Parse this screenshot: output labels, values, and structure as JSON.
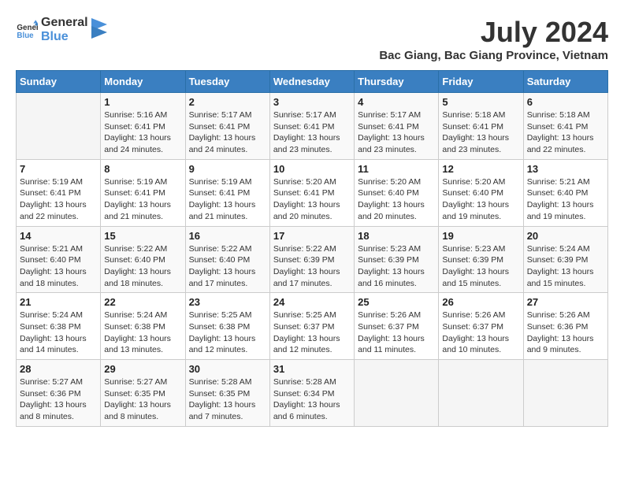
{
  "header": {
    "logo_line1": "General",
    "logo_line2": "Blue",
    "month_year": "July 2024",
    "location": "Bac Giang, Bac Giang Province, Vietnam"
  },
  "days_of_week": [
    "Sunday",
    "Monday",
    "Tuesday",
    "Wednesday",
    "Thursday",
    "Friday",
    "Saturday"
  ],
  "weeks": [
    [
      {
        "day": "",
        "detail": ""
      },
      {
        "day": "1",
        "detail": "Sunrise: 5:16 AM\nSunset: 6:41 PM\nDaylight: 13 hours\nand 24 minutes."
      },
      {
        "day": "2",
        "detail": "Sunrise: 5:17 AM\nSunset: 6:41 PM\nDaylight: 13 hours\nand 24 minutes."
      },
      {
        "day": "3",
        "detail": "Sunrise: 5:17 AM\nSunset: 6:41 PM\nDaylight: 13 hours\nand 23 minutes."
      },
      {
        "day": "4",
        "detail": "Sunrise: 5:17 AM\nSunset: 6:41 PM\nDaylight: 13 hours\nand 23 minutes."
      },
      {
        "day": "5",
        "detail": "Sunrise: 5:18 AM\nSunset: 6:41 PM\nDaylight: 13 hours\nand 23 minutes."
      },
      {
        "day": "6",
        "detail": "Sunrise: 5:18 AM\nSunset: 6:41 PM\nDaylight: 13 hours\nand 22 minutes."
      }
    ],
    [
      {
        "day": "7",
        "detail": ""
      },
      {
        "day": "8",
        "detail": "Sunrise: 5:19 AM\nSunset: 6:41 PM\nDaylight: 13 hours\nand 21 minutes."
      },
      {
        "day": "9",
        "detail": "Sunrise: 5:19 AM\nSunset: 6:41 PM\nDaylight: 13 hours\nand 21 minutes."
      },
      {
        "day": "10",
        "detail": "Sunrise: 5:20 AM\nSunset: 6:41 PM\nDaylight: 13 hours\nand 20 minutes."
      },
      {
        "day": "11",
        "detail": "Sunrise: 5:20 AM\nSunset: 6:40 PM\nDaylight: 13 hours\nand 20 minutes."
      },
      {
        "day": "12",
        "detail": "Sunrise: 5:20 AM\nSunset: 6:40 PM\nDaylight: 13 hours\nand 19 minutes."
      },
      {
        "day": "13",
        "detail": "Sunrise: 5:21 AM\nSunset: 6:40 PM\nDaylight: 13 hours\nand 19 minutes."
      }
    ],
    [
      {
        "day": "14",
        "detail": ""
      },
      {
        "day": "15",
        "detail": "Sunrise: 5:22 AM\nSunset: 6:40 PM\nDaylight: 13 hours\nand 18 minutes."
      },
      {
        "day": "16",
        "detail": "Sunrise: 5:22 AM\nSunset: 6:40 PM\nDaylight: 13 hours\nand 17 minutes."
      },
      {
        "day": "17",
        "detail": "Sunrise: 5:22 AM\nSunset: 6:39 PM\nDaylight: 13 hours\nand 17 minutes."
      },
      {
        "day": "18",
        "detail": "Sunrise: 5:23 AM\nSunset: 6:39 PM\nDaylight: 13 hours\nand 16 minutes."
      },
      {
        "day": "19",
        "detail": "Sunrise: 5:23 AM\nSunset: 6:39 PM\nDaylight: 13 hours\nand 15 minutes."
      },
      {
        "day": "20",
        "detail": "Sunrise: 5:24 AM\nSunset: 6:39 PM\nDaylight: 13 hours\nand 15 minutes."
      }
    ],
    [
      {
        "day": "21",
        "detail": ""
      },
      {
        "day": "22",
        "detail": "Sunrise: 5:24 AM\nSunset: 6:38 PM\nDaylight: 13 hours\nand 13 minutes."
      },
      {
        "day": "23",
        "detail": "Sunrise: 5:25 AM\nSunset: 6:38 PM\nDaylight: 13 hours\nand 12 minutes."
      },
      {
        "day": "24",
        "detail": "Sunrise: 5:25 AM\nSunset: 6:37 PM\nDaylight: 13 hours\nand 12 minutes."
      },
      {
        "day": "25",
        "detail": "Sunrise: 5:26 AM\nSunset: 6:37 PM\nDaylight: 13 hours\nand 11 minutes."
      },
      {
        "day": "26",
        "detail": "Sunrise: 5:26 AM\nSunset: 6:37 PM\nDaylight: 13 hours\nand 10 minutes."
      },
      {
        "day": "27",
        "detail": "Sunrise: 5:26 AM\nSunset: 6:36 PM\nDaylight: 13 hours\nand 9 minutes."
      }
    ],
    [
      {
        "day": "28",
        "detail": "Sunrise: 5:27 AM\nSunset: 6:36 PM\nDaylight: 13 hours\nand 8 minutes."
      },
      {
        "day": "29",
        "detail": "Sunrise: 5:27 AM\nSunset: 6:35 PM\nDaylight: 13 hours\nand 8 minutes."
      },
      {
        "day": "30",
        "detail": "Sunrise: 5:28 AM\nSunset: 6:35 PM\nDaylight: 13 hours\nand 7 minutes."
      },
      {
        "day": "31",
        "detail": "Sunrise: 5:28 AM\nSunset: 6:34 PM\nDaylight: 13 hours\nand 6 minutes."
      },
      {
        "day": "",
        "detail": ""
      },
      {
        "day": "",
        "detail": ""
      },
      {
        "day": "",
        "detail": ""
      }
    ]
  ],
  "week1_sunday": "Sunrise: 5:19 AM\nSunset: 6:41 PM\nDaylight: 13 hours\nand 22 minutes.",
  "week3_sunday": "Sunrise: 5:21 AM\nSunset: 6:40 PM\nDaylight: 13 hours\nand 18 minutes.",
  "week4_sunday": "Sunrise: 5:24 AM\nSunset: 6:38 PM\nDaylight: 13 hours\nand 14 minutes."
}
